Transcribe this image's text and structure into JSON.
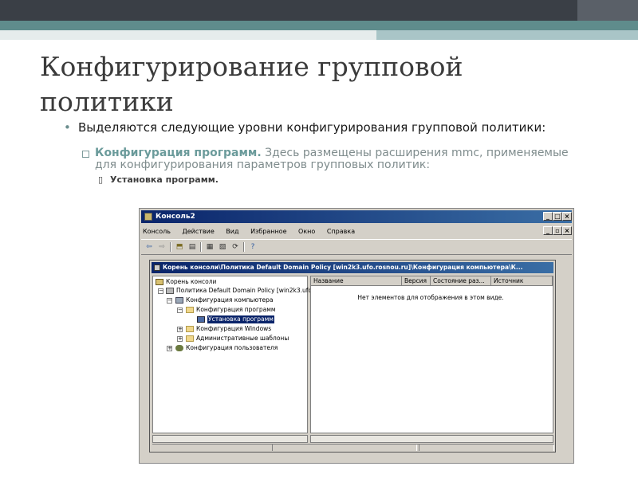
{
  "slide": {
    "title_line1": "Конфигурирование групповой",
    "title_line2": "политики",
    "bullet1": "Выделяются следующие уровни конфигурирования групповой политики:",
    "bullet2_highlight": "Конфигурация программ.",
    "bullet2_rest": " Здесь размещены расширения mmc, применяемые для конфигурирования параметров групповых политик:",
    "bullet3": "Установка программ."
  },
  "window": {
    "title": "Консоль2",
    "menu": [
      "Консоль",
      "Действие",
      "Вид",
      "Избранное",
      "Окно",
      "Справка"
    ]
  },
  "child": {
    "title": "Корень консоли\\Политика Default Domain Policy [win2k3.ufo.rosnou.ru]\\Конфигурация компьютера\\К...",
    "tree": [
      {
        "label": "Корень консоли"
      },
      {
        "label": "Политика Default Domain Policy [win2k3.ufo.r"
      },
      {
        "label": "Конфигурация компьютера"
      },
      {
        "label": "Конфигурация программ"
      },
      {
        "label": "Установка программ"
      },
      {
        "label": "Конфигурация Windows"
      },
      {
        "label": "Административные шаблоны"
      },
      {
        "label": "Конфигурация пользователя"
      }
    ],
    "columns": [
      "Название",
      "Версия",
      "Состояние раз...",
      "Источник"
    ],
    "empty_text": "Нет элементов для отображения в этом виде."
  }
}
